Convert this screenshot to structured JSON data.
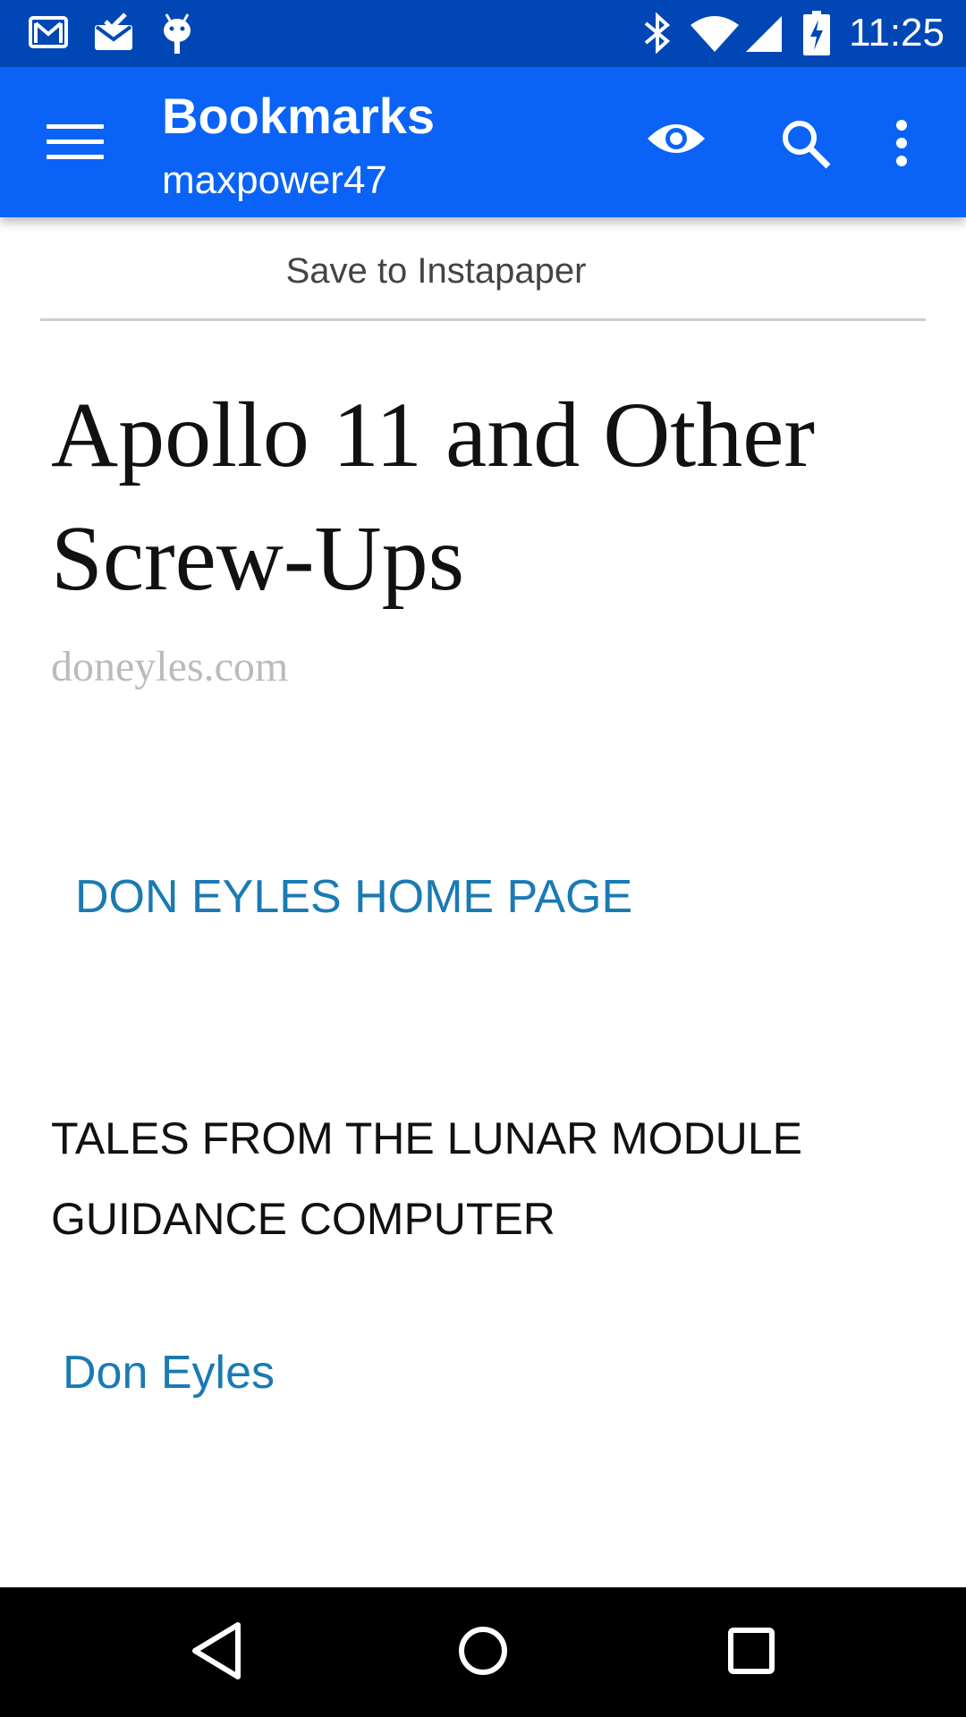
{
  "status_bar": {
    "time": "11:25",
    "left_icons": [
      "gmail-icon",
      "inbox-icon",
      "android-debug-icon"
    ],
    "right_icons": [
      "bluetooth-icon",
      "wifi-icon",
      "cell-signal-icon",
      "battery-charging-icon"
    ]
  },
  "app_bar": {
    "title": "Bookmarks",
    "subtitle": "maxpower47",
    "color": "#0a63f6",
    "actions": [
      "eye-icon",
      "search-icon",
      "more-vert-icon"
    ]
  },
  "content": {
    "save_label": "Save to Instapaper",
    "article_title": "Apollo 11 and Other Screw-Ups",
    "domain": "doneyles.com",
    "home_link": "DON EYLES HOME PAGE",
    "tales": "TALES FROM THE LUNAR MODULE GUIDANCE COMPUTER",
    "author": "Don Eyles",
    "link_color": "#1a7ab4"
  },
  "nav_bar": {
    "buttons": [
      "back-icon",
      "home-icon",
      "recents-icon"
    ]
  }
}
